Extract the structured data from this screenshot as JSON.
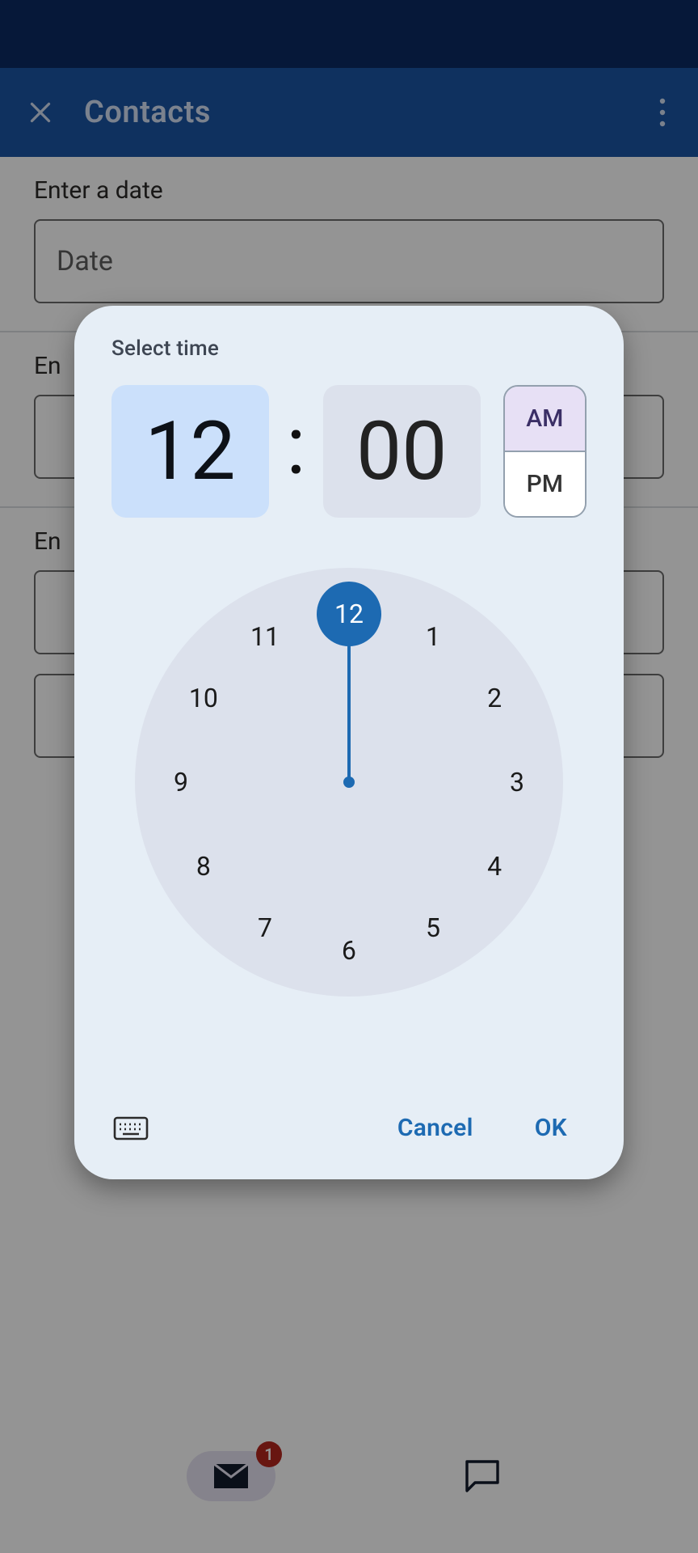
{
  "header": {
    "title": "Contacts"
  },
  "form": {
    "block1": {
      "label": "Enter a date",
      "placeholder": "Date"
    },
    "block2": {
      "label": "En"
    },
    "block3": {
      "label": "En"
    }
  },
  "nav": {
    "badge": "1"
  },
  "dialog": {
    "title": "Select time",
    "hour": "12",
    "minute": "00",
    "am": "AM",
    "pm": "PM",
    "selected_period": "AM",
    "selected_hour": 12,
    "clock_numbers": [
      "12",
      "1",
      "2",
      "3",
      "4",
      "5",
      "6",
      "7",
      "8",
      "9",
      "10",
      "11"
    ],
    "cancel": "Cancel",
    "ok": "OK"
  },
  "colors": {
    "accent": "#1d6ab2",
    "app_bar": "#1b55a4",
    "status_bar": "#0b2a62"
  }
}
